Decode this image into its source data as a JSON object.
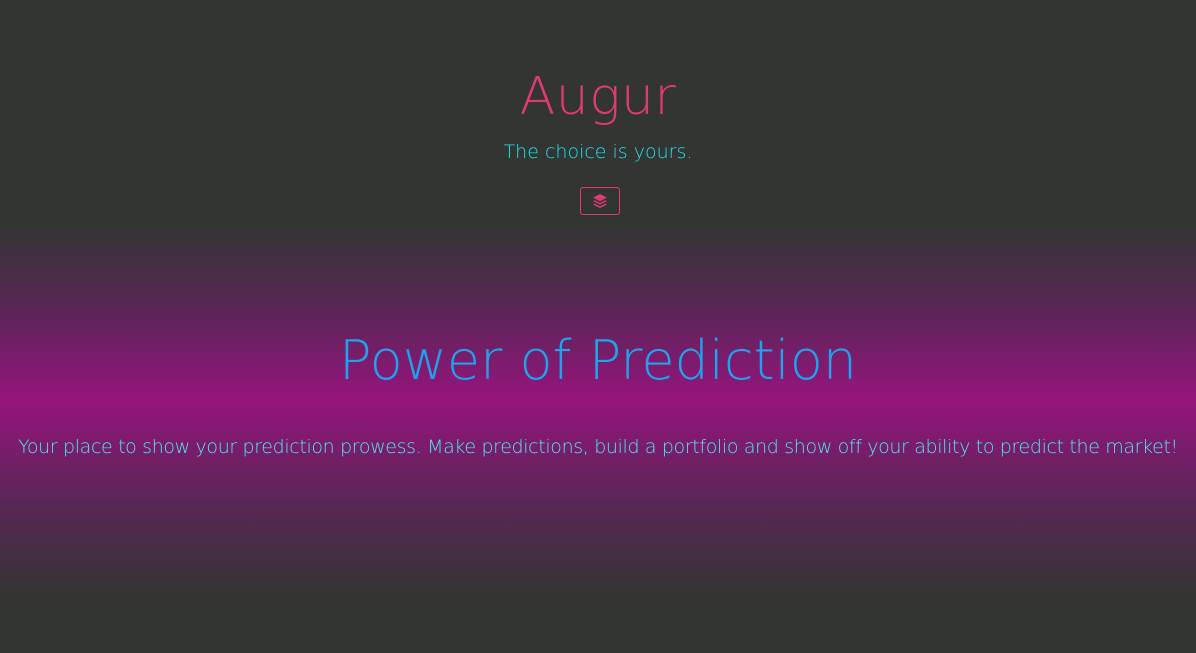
{
  "header": {
    "title": "Augur",
    "tagline": "The choice is yours.",
    "layers_button_icon": "layers-icon"
  },
  "feature": {
    "heading": "Power of Prediction",
    "description": "Your place to show your prediction prowess. Make predictions, build a portfolio and show off your ability to predict the market!"
  },
  "colors": {
    "brand_pink": "#e03a73",
    "tagline_cyan": "#21e2ee",
    "heading_blue": "#1fa3ee",
    "text_cyan": "#4fe6f4",
    "background_dark": "#333532",
    "background_magenta": "#96147d"
  }
}
